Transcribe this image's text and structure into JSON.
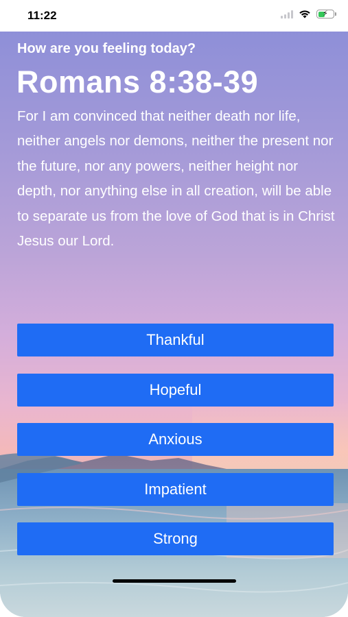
{
  "status_bar": {
    "time": "11:22",
    "icons": [
      "signal-icon",
      "wifi-icon",
      "battery-charging-icon"
    ]
  },
  "mood_screen": {
    "prompt": "How are you feeling today?",
    "verse_reference": "Romans 8:38-39",
    "verse_text": "For I am convinced that neither death nor life, neither angels nor demons, neither the present nor the future, nor any powers, neither height nor depth, nor anything else in all creation, will be able to separate us from the love of God that is in Christ Jesus our Lord.",
    "moods": [
      {
        "label": "Thankful"
      },
      {
        "label": "Hopeful"
      },
      {
        "label": "Anxious"
      },
      {
        "label": "Impatient"
      },
      {
        "label": "Strong"
      }
    ]
  },
  "colors": {
    "button_blue": "#1f6cf4",
    "text": "#ffffff",
    "battery_green": "#34c759"
  }
}
